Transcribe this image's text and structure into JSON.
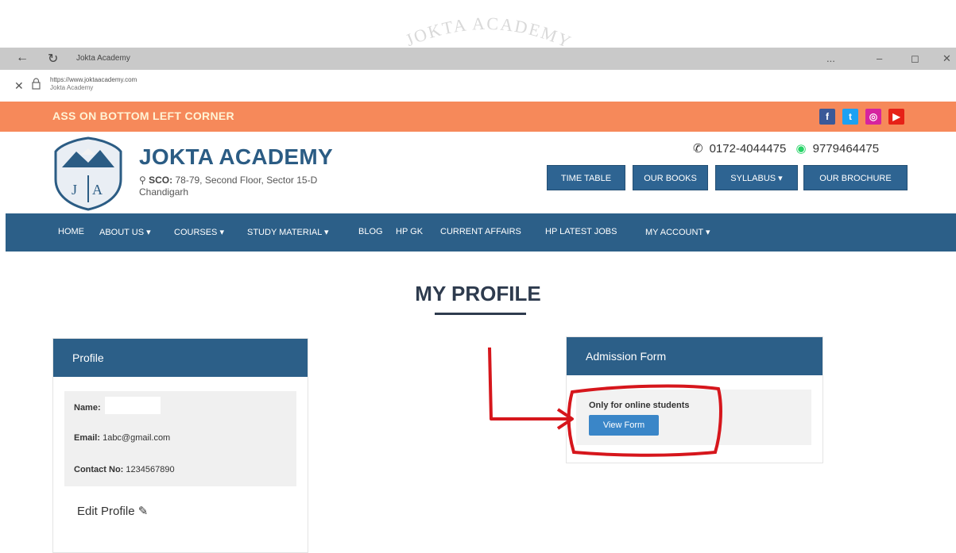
{
  "browser": {
    "tab_title": "Jokta Academy",
    "url": "https://www.joktaacademy.com",
    "url_site_name": "Jokta Academy",
    "more_label": "...",
    "minimize_label": "–",
    "maximize_label": "◻",
    "close_label": "✕",
    "close_tab_label": "✕"
  },
  "watermark": "JOKTA ACADEMY",
  "topbar": {
    "marquee_text": "ASS ON BOTTOM LEFT CORNER",
    "social": [
      {
        "icon": "facebook-icon",
        "glyph": "f",
        "color": "#3b5998"
      },
      {
        "icon": "twitter-icon",
        "glyph": "t",
        "color": "#1da1f2"
      },
      {
        "icon": "instagram-icon",
        "glyph": "◎",
        "color": "#d6249f"
      },
      {
        "icon": "youtube-icon",
        "glyph": "▶",
        "color": "#e62117"
      }
    ]
  },
  "header": {
    "logo_letters": "JA",
    "brand": "JOKTA ACADEMY",
    "address_label": "SCO:",
    "address_line1": "78-79, Second Floor, Sector 15-D",
    "address_line2": "Chandigarh",
    "phone": "0172-4044475",
    "whatsapp": "9779464475",
    "buttons": [
      "TIME TABLE",
      "OUR BOOKS",
      "SYLLABUS ▾",
      "OUR BROCHURE"
    ]
  },
  "nav": {
    "items": [
      "HOME",
      "ABOUT US ▾",
      "COURSES ▾",
      "STUDY MATERIAL ▾",
      "BLOG",
      "HP GK",
      "CURRENT AFFAIRS",
      "HP LATEST JOBS",
      "MY ACCOUNT ▾"
    ]
  },
  "page": {
    "title": "MY PROFILE"
  },
  "profile": {
    "heading": "Profile",
    "name_label": "Name:",
    "name_value": "",
    "email_label": "Email:",
    "email_value": "1abc@gmail.com",
    "contact_label": "Contact No:",
    "contact_value": "1234567890",
    "edit_label": "Edit Profile"
  },
  "admission": {
    "heading": "Admission Form",
    "note": "Only for online students",
    "button_label": "View Form"
  },
  "colors": {
    "orange_bar": "#f6895a",
    "navy": "#2c5f88",
    "button_blue": "#3a86c8",
    "annotation_red": "#d6161c"
  }
}
